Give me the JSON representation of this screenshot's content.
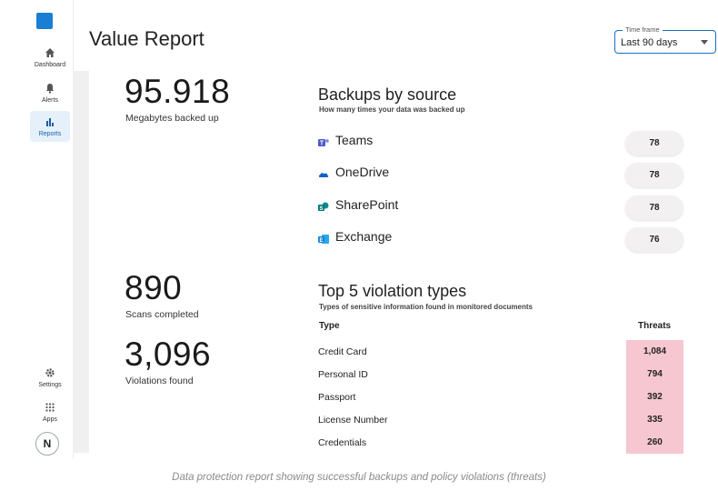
{
  "page": {
    "title": "Value Report"
  },
  "timeframe": {
    "legend": "Time frame",
    "value": "Last 90 days"
  },
  "sidebar": {
    "items": [
      {
        "label": "Dashboard",
        "icon": "home-icon",
        "active": false
      },
      {
        "label": "Alerts",
        "icon": "bell-icon",
        "active": false
      },
      {
        "label": "Reports",
        "icon": "bar-chart-icon",
        "active": true
      },
      {
        "label": "Settings",
        "icon": "gear-icon",
        "active": false
      },
      {
        "label": "Apps",
        "icon": "grid-icon",
        "active": false
      }
    ],
    "avatar": "N"
  },
  "kpis": {
    "backed_up": {
      "value": "95.918",
      "label": "Megabytes backed up"
    },
    "scans": {
      "value": "890",
      "label": "Scans completed"
    },
    "violations": {
      "value": "3,096",
      "label": "Violations found"
    }
  },
  "backups": {
    "title": "Backups by source",
    "subtitle": "How many times your data was backed up",
    "sources": [
      {
        "name": "Teams",
        "count": "78",
        "icon": "teams-icon",
        "color": "#5059c9"
      },
      {
        "name": "OneDrive",
        "count": "78",
        "icon": "onedrive-icon",
        "color": "#0a64c8"
      },
      {
        "name": "SharePoint",
        "count": "78",
        "icon": "sharepoint-icon",
        "color": "#037a79"
      },
      {
        "name": "Exchange",
        "count": "76",
        "icon": "exchange-icon",
        "color": "#1481d8"
      }
    ]
  },
  "violations": {
    "title": "Top 5 violation types",
    "subtitle": "Types of sensitive information found in monitored documents",
    "col_type": "Type",
    "col_threats": "Threats",
    "rows": [
      {
        "type": "Credit Card",
        "threats": "1,084"
      },
      {
        "type": "Personal ID",
        "threats": "794"
      },
      {
        "type": "Passport",
        "threats": "392"
      },
      {
        "type": "License Number",
        "threats": "335"
      },
      {
        "type": "Credentials",
        "threats": "260"
      }
    ]
  },
  "caption": "Data protection report showing successful backups and policy violations (threats)",
  "colors": {
    "accent": "#1a7fd4",
    "threat_fill": "#f6c7d0",
    "active_nav": "#e5f0fb"
  }
}
